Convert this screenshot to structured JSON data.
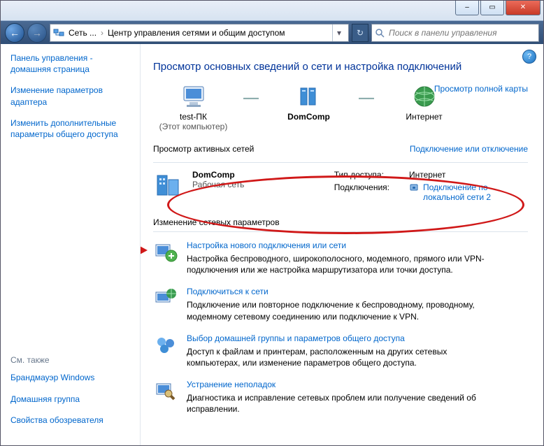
{
  "titlebar": {
    "minimize": "–",
    "maximize": "▭",
    "close": "✕"
  },
  "nav": {
    "back": "←",
    "forward": "→",
    "crumb1": "Сеть ...",
    "sep": "›",
    "crumb2": "Центр управления сетями и общим доступом",
    "dropdown": "▾",
    "refresh": "↻",
    "search_placeholder": "Поиск в панели управления"
  },
  "sidebar": {
    "links": [
      "Панель управления - домашняя страница",
      "Изменение параметров адаптера",
      "Изменить дополнительные параметры общего доступа"
    ],
    "see_also_heading": "См. также",
    "see_also": [
      "Брандмауэр Windows",
      "Домашняя группа",
      "Свойства обозревателя"
    ]
  },
  "main": {
    "title": "Просмотр основных сведений о сети и настройка подключений",
    "map": {
      "pc_name": "test-ПК",
      "pc_sub": "(Этот компьютер)",
      "domain": "DomComp",
      "internet": "Интернет",
      "view_full": "Просмотр полной карты"
    },
    "active_label": "Просмотр активных сетей",
    "active_link": "Подключение или отключение",
    "net": {
      "name": "DomComp",
      "type": "Рабочая сеть",
      "access_label": "Тип доступа:",
      "access_value": "Интернет",
      "conn_label": "Подключения:",
      "conn_value": "Подключение по локальной сети 2"
    },
    "change_heading": "Изменение сетевых параметров",
    "tasks": [
      {
        "title": "Настройка нового подключения или сети",
        "desc": "Настройка беспроводного, широкополосного, модемного, прямого или VPN-подключения или же настройка маршрутизатора или точки доступа."
      },
      {
        "title": "Подключиться к сети",
        "desc": "Подключение или повторное подключение к беспроводному, проводному, модемному сетевому соединению или подключение к VPN."
      },
      {
        "title": "Выбор домашней группы и параметров общего доступа",
        "desc": "Доступ к файлам и принтерам, расположенным на других сетевых компьютерах, или изменение параметров общего доступа."
      },
      {
        "title": "Устранение неполадок",
        "desc": "Диагностика и исправление сетевых проблем или получение сведений об исправлении."
      }
    ]
  }
}
